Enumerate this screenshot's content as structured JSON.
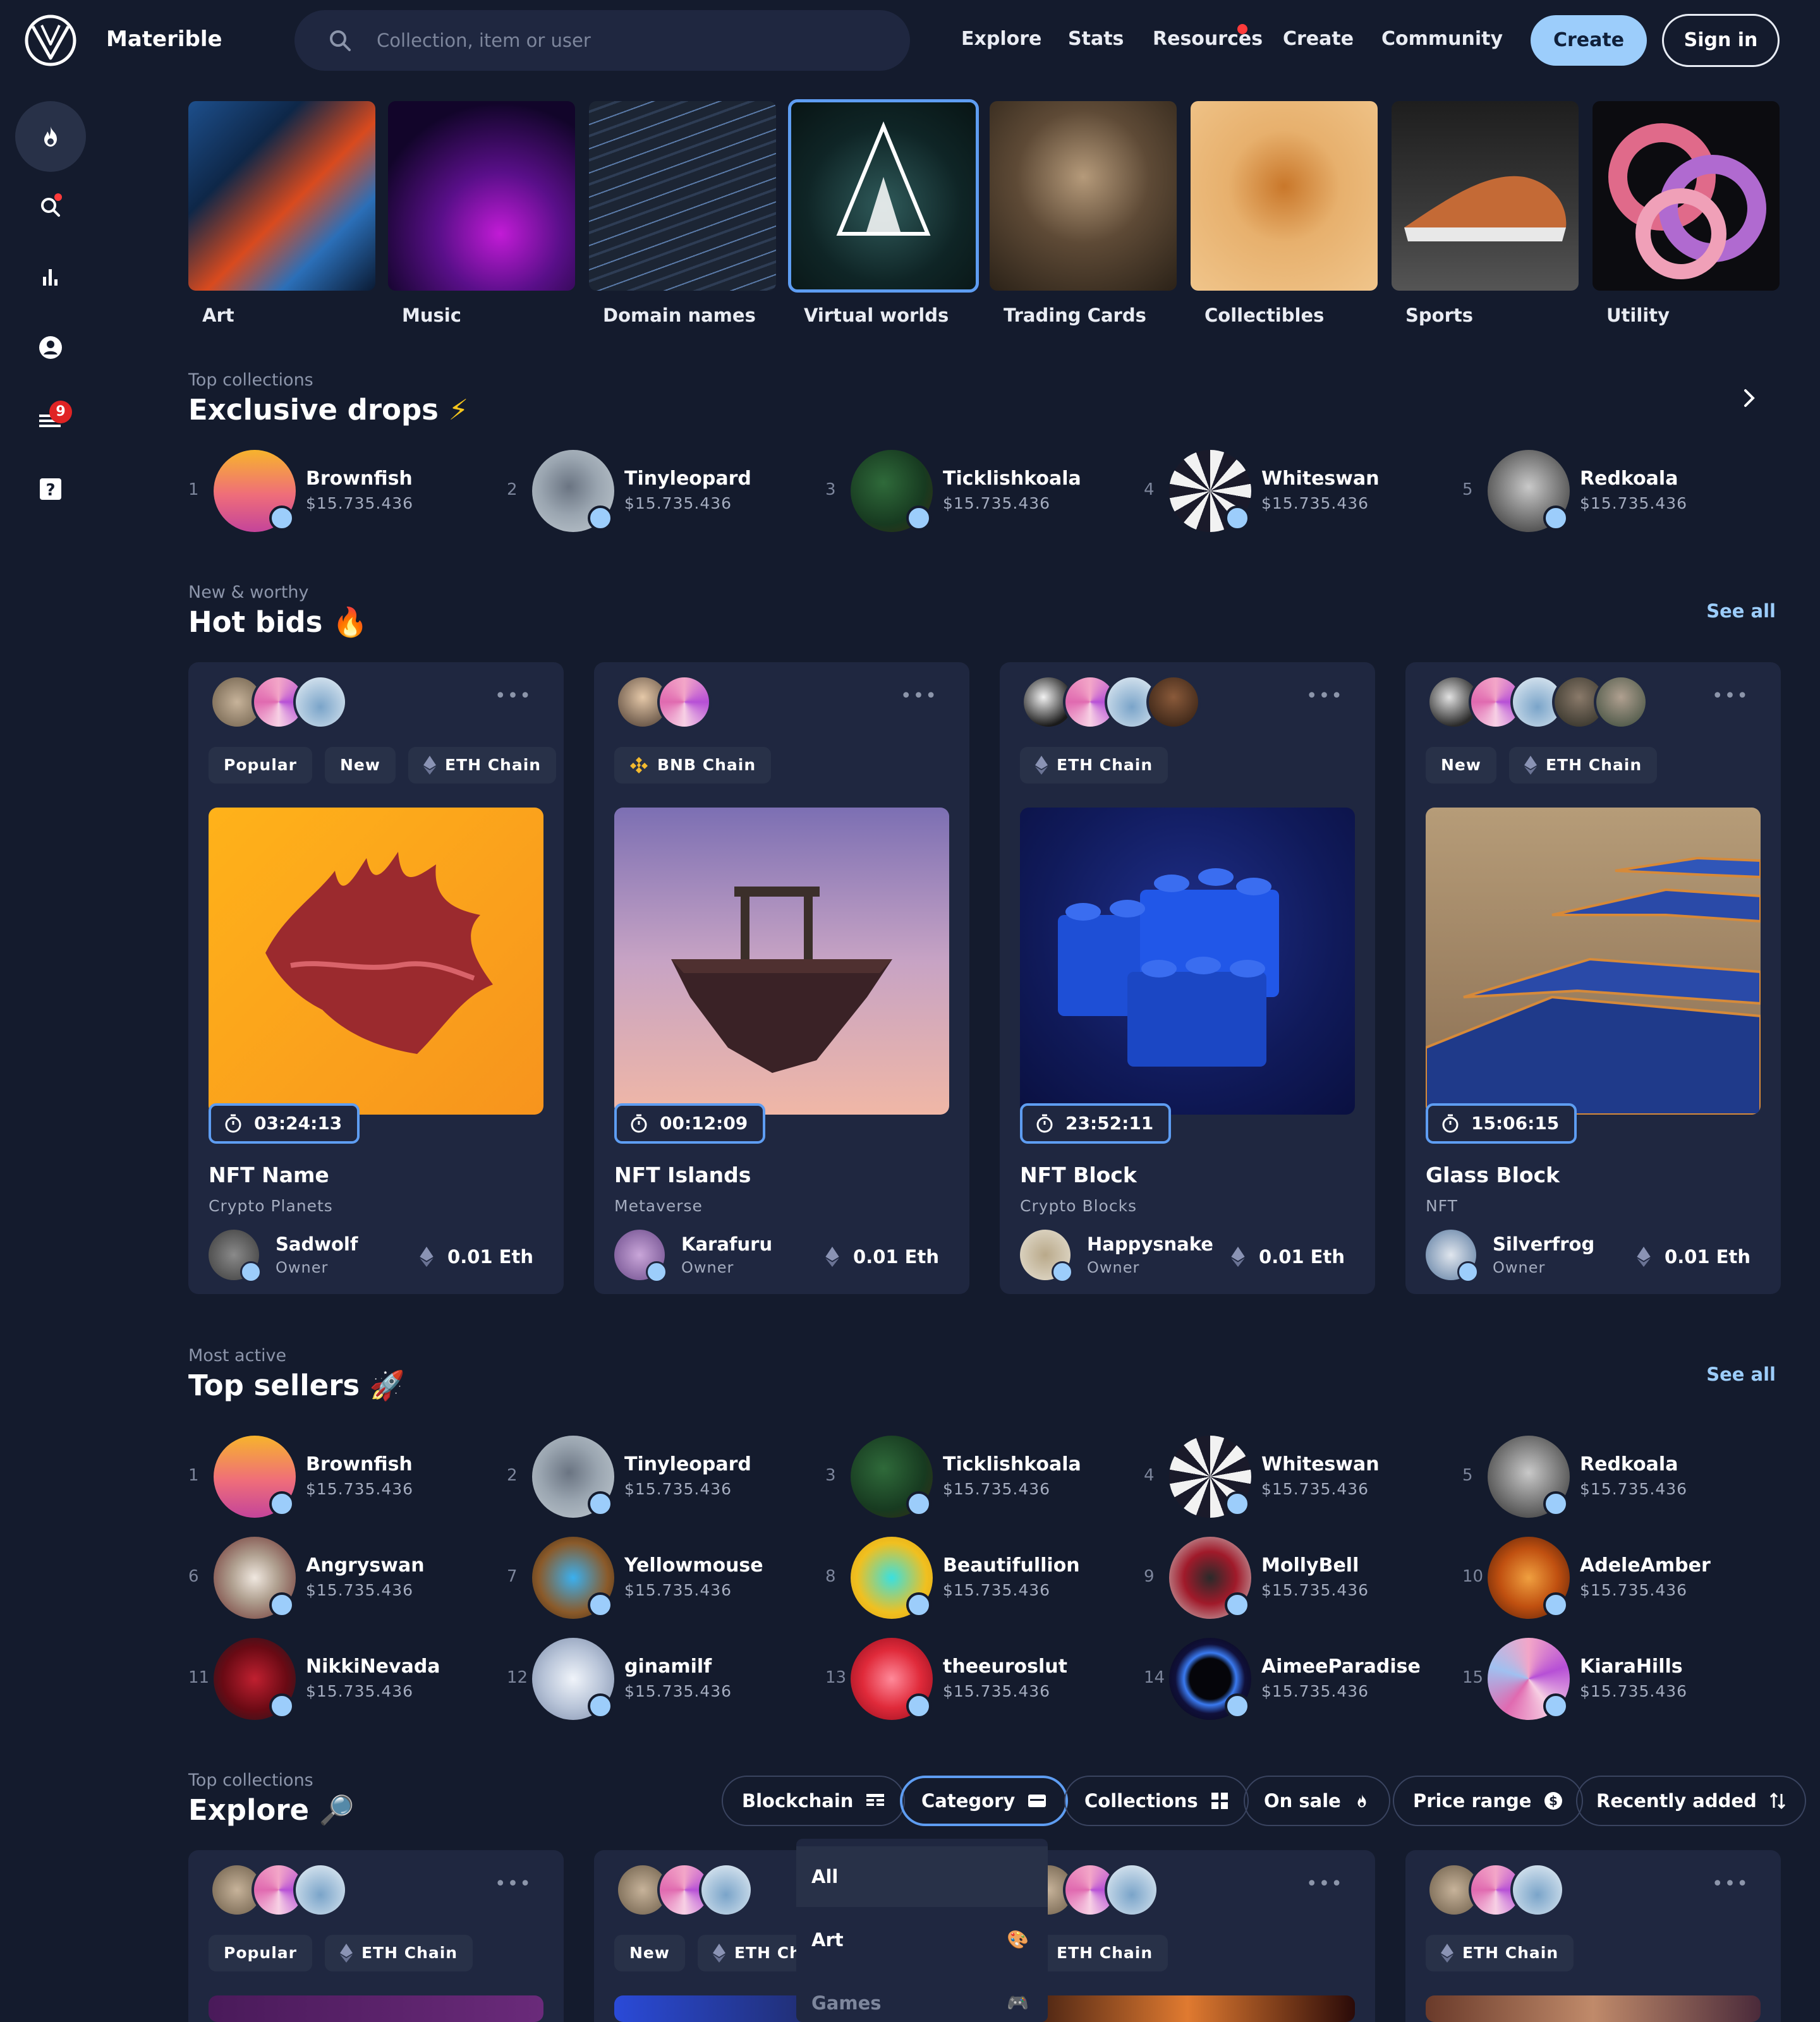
{
  "app": {
    "name": "Materible"
  },
  "search": {
    "placeholder": "Collection, item or user"
  },
  "nav": {
    "items": [
      "Explore",
      "Stats",
      "Resources",
      "Create",
      "Community"
    ],
    "create_label": "Create",
    "signin_label": "Sign in"
  },
  "sidebar": {
    "icons": [
      "fire-icon",
      "search-icon",
      "stats-icon",
      "profile-icon",
      "activity-icon",
      "help-icon"
    ],
    "activity_badge": "9"
  },
  "categories": [
    "Art",
    "Music",
    "Domain names",
    "Virtual worlds",
    "Trading Cards",
    "Collectibles",
    "Sports",
    "Utility"
  ],
  "selected_category": "Virtual worlds",
  "exclusive": {
    "subtitle": "Top collections",
    "title": "Exclusive drops",
    "users": [
      {
        "rank": "1",
        "name": "Brownfish",
        "value": "$15.735.436"
      },
      {
        "rank": "2",
        "name": "Tinyleopard",
        "value": "$15.735.436"
      },
      {
        "rank": "3",
        "name": "Ticklishkoala",
        "value": "$15.735.436"
      },
      {
        "rank": "4",
        "name": "Whiteswan",
        "value": "$15.735.436"
      },
      {
        "rank": "5",
        "name": "Redkoala",
        "value": "$15.735.436"
      }
    ]
  },
  "hot": {
    "subtitle": "New & worthy",
    "title": "Hot bids",
    "see_all": "See all",
    "cards": [
      {
        "tags": [
          "Popular",
          "New",
          "ETH Chain"
        ],
        "timer": "03:24:13",
        "name": "NFT Name",
        "collection": "Crypto Planets",
        "owner": "Sadwolf",
        "role": "Owner",
        "price": "0.01 Eth"
      },
      {
        "tags": [
          "BNB Chain"
        ],
        "timer": "00:12:09",
        "name": "NFT Islands",
        "collection": "Metaverse",
        "owner": "Karafuru",
        "role": "Owner",
        "price": "0.01 Eth"
      },
      {
        "tags": [
          "ETH Chain"
        ],
        "timer": "23:52:11",
        "name": "NFT Block",
        "collection": "Crypto Blocks",
        "owner": "Happysnake",
        "role": "Owner",
        "price": "0.01 Eth"
      },
      {
        "tags": [
          "New",
          "ETH Chain"
        ],
        "timer": "15:06:15",
        "name": "Glass Block",
        "collection": "NFT",
        "owner": "Silverfrog",
        "role": "Owner",
        "price": "0.01 Eth"
      }
    ]
  },
  "sellers": {
    "subtitle": "Most active",
    "title": "Top sellers",
    "see_all": "See all",
    "users": [
      {
        "rank": "1",
        "name": "Brownfish",
        "value": "$15.735.436"
      },
      {
        "rank": "2",
        "name": "Tinyleopard",
        "value": "$15.735.436"
      },
      {
        "rank": "3",
        "name": "Ticklishkoala",
        "value": "$15.735.436"
      },
      {
        "rank": "4",
        "name": "Whiteswan",
        "value": "$15.735.436"
      },
      {
        "rank": "5",
        "name": "Redkoala",
        "value": "$15.735.436"
      },
      {
        "rank": "6",
        "name": "Angryswan",
        "value": "$15.735.436"
      },
      {
        "rank": "7",
        "name": "Yellowmouse",
        "value": "$15.735.436"
      },
      {
        "rank": "8",
        "name": "Beautifullion",
        "value": "$15.735.436"
      },
      {
        "rank": "9",
        "name": "MollyBell",
        "value": "$15.735.436"
      },
      {
        "rank": "10",
        "name": "AdeleAmber",
        "value": "$15.735.436"
      },
      {
        "rank": "11",
        "name": "NikkiNevada",
        "value": "$15.735.436"
      },
      {
        "rank": "12",
        "name": "ginamilf",
        "value": "$15.735.436"
      },
      {
        "rank": "13",
        "name": "theeuroslut",
        "value": "$15.735.436"
      },
      {
        "rank": "14",
        "name": "AimeeParadise",
        "value": "$15.735.436"
      },
      {
        "rank": "15",
        "name": "KiaraHills",
        "value": "$15.735.436"
      }
    ]
  },
  "explore": {
    "subtitle": "Top collections",
    "title": "Explore",
    "filters": [
      "Blockchain",
      "Category",
      "Collections",
      "On sale",
      "Price range",
      "Recently added"
    ],
    "active_filter": "Category",
    "dropdown": [
      "All",
      "Art",
      "Games"
    ],
    "cards": [
      {
        "tags": [
          "Popular",
          "ETH Chain"
        ]
      },
      {
        "tags": [
          "New",
          "ETH Chain"
        ]
      },
      {
        "tags": [
          "ETH Chain"
        ]
      },
      {
        "tags": [
          "ETH Chain"
        ]
      }
    ]
  },
  "colors": {
    "background": "#141b2d",
    "card": "#1f2740",
    "accent": "#9ccdfb",
    "highlight": "#5e9df2"
  }
}
